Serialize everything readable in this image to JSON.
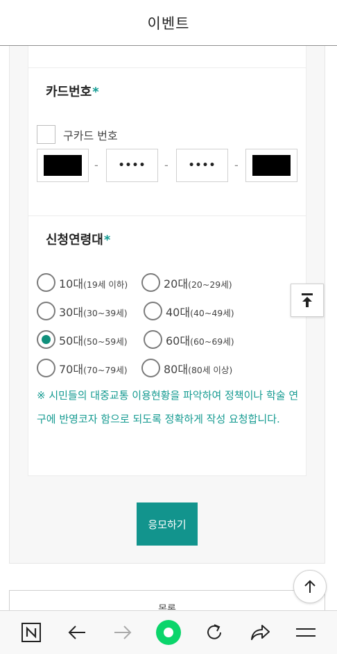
{
  "header": {
    "title": "이벤트"
  },
  "card_section": {
    "title": "카드번호",
    "required_mark": "*",
    "old_card_label": "구카드 번호",
    "inputs": [
      {
        "value": ""
      },
      {
        "value": "••••"
      },
      {
        "value": "••••"
      },
      {
        "value": ""
      }
    ],
    "separator": "-"
  },
  "age_section": {
    "title": "신청연령대",
    "required_mark": "*",
    "options": [
      {
        "label": "10대",
        "sub": "(19세 이하)",
        "checked": false
      },
      {
        "label": "20대",
        "sub": "(20~29세)",
        "checked": false
      },
      {
        "label": "30대",
        "sub": "(30~39세)",
        "checked": false
      },
      {
        "label": "40대",
        "sub": "(40~49세)",
        "checked": false
      },
      {
        "label": "50대",
        "sub": "(50~59세)",
        "checked": true
      },
      {
        "label": "60대",
        "sub": "(60~69세)",
        "checked": false
      },
      {
        "label": "70대",
        "sub": "(70~79세)",
        "checked": false
      },
      {
        "label": "80대",
        "sub": "(80세 이상)",
        "checked": false
      }
    ],
    "notice": "※ 시민들의 대중교통 이용현황을 파악하여 정책이나 학술 연구에 반영코자 함으로 되도록 정확하게 작성 요청합니다."
  },
  "submit_label": "응모하기",
  "list_label": "목록",
  "colors": {
    "accent": "#12948d",
    "radio_checked": "#0f8f7b",
    "notice_text": "#139a90"
  },
  "bottom_nav": {
    "items": [
      {
        "icon": "naver-n-icon"
      },
      {
        "icon": "back-arrow-icon"
      },
      {
        "icon": "forward-arrow-icon"
      },
      {
        "icon": "home-dot-icon"
      },
      {
        "icon": "refresh-icon"
      },
      {
        "icon": "share-icon"
      },
      {
        "icon": "menu-icon"
      }
    ]
  }
}
